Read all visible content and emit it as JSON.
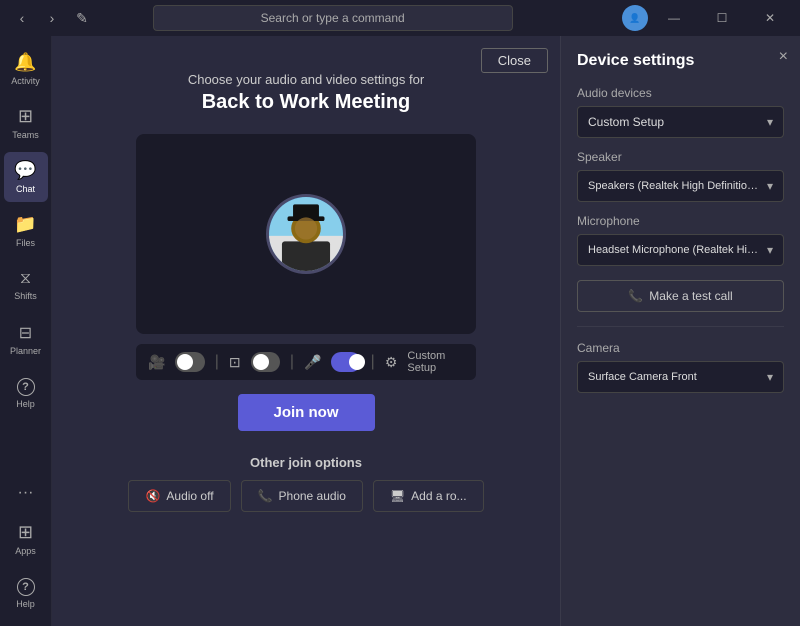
{
  "titlebar": {
    "back_label": "‹",
    "forward_label": "›",
    "compose_label": "✎",
    "search_placeholder": "Search or type a command",
    "minimize_label": "—",
    "maximize_label": "☐",
    "close_label": "✕"
  },
  "sidebar": {
    "items": [
      {
        "id": "activity",
        "label": "Activity",
        "icon": "🔔"
      },
      {
        "id": "teams",
        "label": "Teams",
        "icon": "⊞"
      },
      {
        "id": "chat",
        "label": "Chat",
        "icon": "💬",
        "active": true
      },
      {
        "id": "files",
        "label": "Files",
        "icon": "📁"
      },
      {
        "id": "shifts",
        "label": "Shifts",
        "icon": "📅"
      },
      {
        "id": "planner",
        "label": "Planner",
        "icon": "📋"
      },
      {
        "id": "help",
        "label": "Help",
        "icon": "?"
      },
      {
        "id": "apps",
        "label": "Apps",
        "icon": "⊞"
      },
      {
        "id": "help2",
        "label": "Help",
        "icon": "?"
      }
    ],
    "more_label": "···"
  },
  "meeting": {
    "close_label": "Close",
    "subtitle": "Choose your audio and video settings for",
    "title": "Back to Work Meeting",
    "join_label": "Join now",
    "other_join_title": "Other join options",
    "controls": {
      "audio_off_label": "Audio off",
      "phone_audio_label": "Phone audio",
      "add_room_label": "Add a ro..."
    },
    "custom_setup_label": "Custom Setup"
  },
  "device_settings": {
    "title": "Device settings",
    "close_label": "×",
    "audio_devices_label": "Audio devices",
    "audio_device_value": "Custom Setup",
    "speaker_label": "Speaker",
    "speaker_value": "Speakers (Realtek High Definition Au...",
    "microphone_label": "Microphone",
    "microphone_value": "Headset Microphone (Realtek High D...",
    "test_call_label": "Make a test call",
    "camera_label": "Camera",
    "camera_value": "Surface Camera Front"
  }
}
